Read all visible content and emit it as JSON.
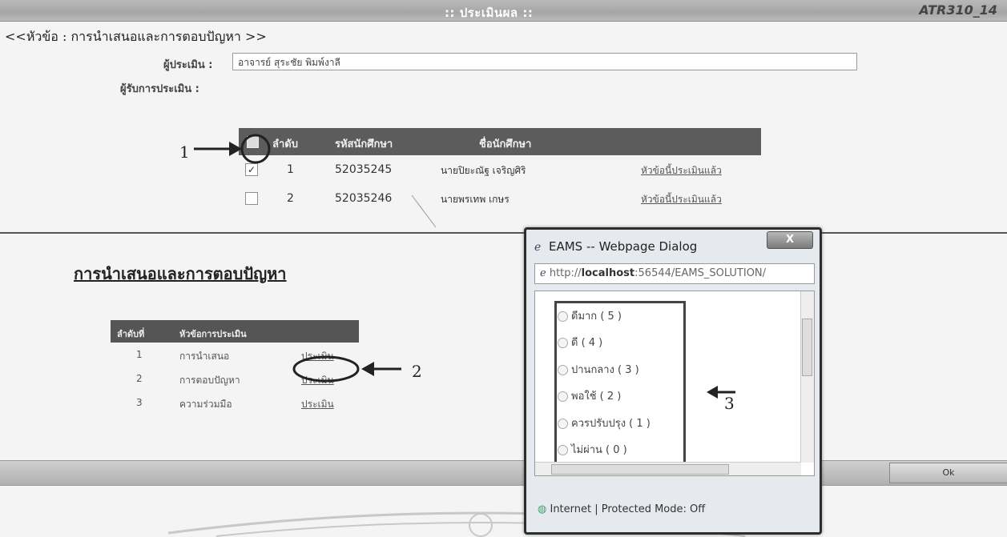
{
  "header": {
    "title": ":: ประเมินผล ::",
    "code": "ATR310_14"
  },
  "topic": "<<หัวข้อ : การนำเสนอและการตอบปัญหา >>",
  "assessor": {
    "label": "ผู้ประเมิน :",
    "value": "อาจารย์ สุระชัย พิมพ์งาลี"
  },
  "assessees_label": "ผู้รับการประเมิน :",
  "students": {
    "headers": [
      "ลำดับ",
      "รหัสนักศึกษา",
      "ชื่อนักศึกษา"
    ],
    "rows": [
      {
        "no": "1",
        "id": "52035245",
        "name": "นายปิยะณัฐ เจริญศิริ",
        "status": "หัวข้อนี้ประเมินแล้ว",
        "checked": true
      },
      {
        "no": "2",
        "id": "52035246",
        "name": "นายพรเทพ เกษร",
        "status": "หัวข้อนี้ประเมินแล้ว",
        "checked": false
      }
    ]
  },
  "section_title": "การนำเสนอและการตอบปัญหา",
  "criteria": {
    "headers": [
      "ลำดับที่",
      "หัวข้อการประเมิน",
      ""
    ],
    "rows": [
      {
        "no": "1",
        "name": "การนำเสนอ",
        "action": "ประเมิน"
      },
      {
        "no": "2",
        "name": "การตอบปัญหา",
        "action": "ประเมิน"
      },
      {
        "no": "3",
        "name": "ความร่วมมือ",
        "action": "ประเมิน"
      }
    ]
  },
  "annotations": [
    "1",
    "2",
    "3"
  ],
  "ok_label": "Ok",
  "dialog": {
    "title": "EAMS -- Webpage Dialog",
    "close": "X",
    "url_prefix": "http://",
    "url_host": "localhost",
    "url_rest": ":56544/EAMS_SOLUTION/",
    "options": [
      "ดีมาก ( 5 )",
      "ดี ( 4 )",
      "ปานกลาง ( 3 )",
      "พอใช้ ( 2 )",
      "ควรปรับปรุง ( 1 )",
      "ไม่ผ่าน ( 0 )"
    ],
    "status": "Internet | Protected Mode: Off"
  }
}
